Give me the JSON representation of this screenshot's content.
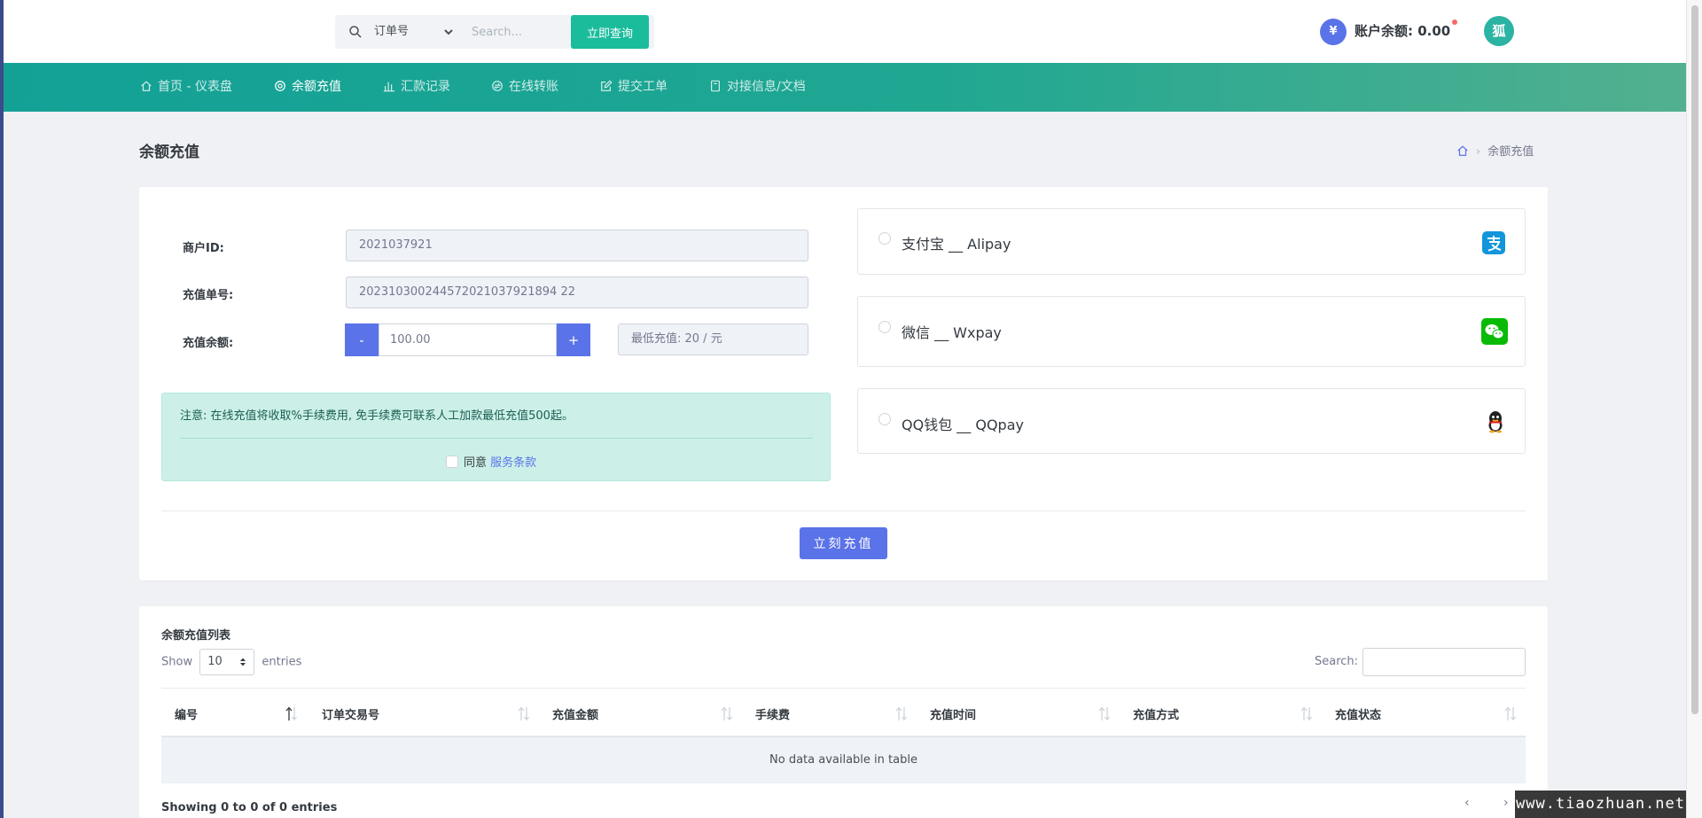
{
  "topbar": {
    "search_select": "订单号",
    "search_placeholder": "Search...",
    "query_button": "立即查询",
    "balance_symbol": "¥",
    "balance_text": "账户余额: 0.00",
    "avatar_text": "狐"
  },
  "nav": {
    "items": [
      {
        "label": "首页 - 仪表盘",
        "icon": "home-icon"
      },
      {
        "label": "余额充值",
        "icon": "target-icon"
      },
      {
        "label": "汇款记录",
        "icon": "bar-chart-icon"
      },
      {
        "label": "在线转账",
        "icon": "transfer-icon"
      },
      {
        "label": "提交工单",
        "icon": "edit-icon"
      },
      {
        "label": "对接信息/文档",
        "icon": "document-icon"
      }
    ],
    "active": 1
  },
  "page": {
    "title": "余额充值",
    "breadcrumb_current": "余额充值"
  },
  "form": {
    "merchant_label": "商户ID:",
    "merchant_value": "2021037921",
    "order_label": "充值单号:",
    "order_value": "202310300244572021037921894 22",
    "amount_label": "充值余额:",
    "amount_value": "100.00",
    "minus": "-",
    "plus": "+",
    "min_text": "最低充值: 20 / 元"
  },
  "notice": {
    "text": "注意: 在线充值将收取%手续费用, 免手续费可联系人工加款最低充值500起。",
    "agree": "同意",
    "terms_link": "服务条款"
  },
  "payment": {
    "options": [
      {
        "label": "支付宝 __ Alipay",
        "icon": "alipay-icon",
        "color": "#1296db"
      },
      {
        "label": "微信 __ Wxpay",
        "icon": "wechat-icon",
        "color": "#09bb07"
      },
      {
        "label": "QQ钱包 __ QQpay",
        "icon": "qq-penguin-icon",
        "color": "#222222"
      }
    ]
  },
  "submit_label": "立刻充值",
  "list": {
    "title": "余额充值列表",
    "show": "Show",
    "length": "10",
    "entries": "entries",
    "search_label": "Search:",
    "columns": [
      "编号",
      "订单交易号",
      "充值金额",
      "手续费",
      "充值时间",
      "充值方式",
      "充值状态"
    ],
    "empty": "No data available in table",
    "info": "Showing 0 to 0 of 0 entries",
    "prev": "‹",
    "next": "›"
  },
  "watermark": "www.tiaozhuan.net",
  "colors": {
    "primary": "#5b73e8",
    "success": "#1abc9c",
    "nav_gradient_start": "#13a196",
    "nav_gradient_end": "#52b08f"
  }
}
